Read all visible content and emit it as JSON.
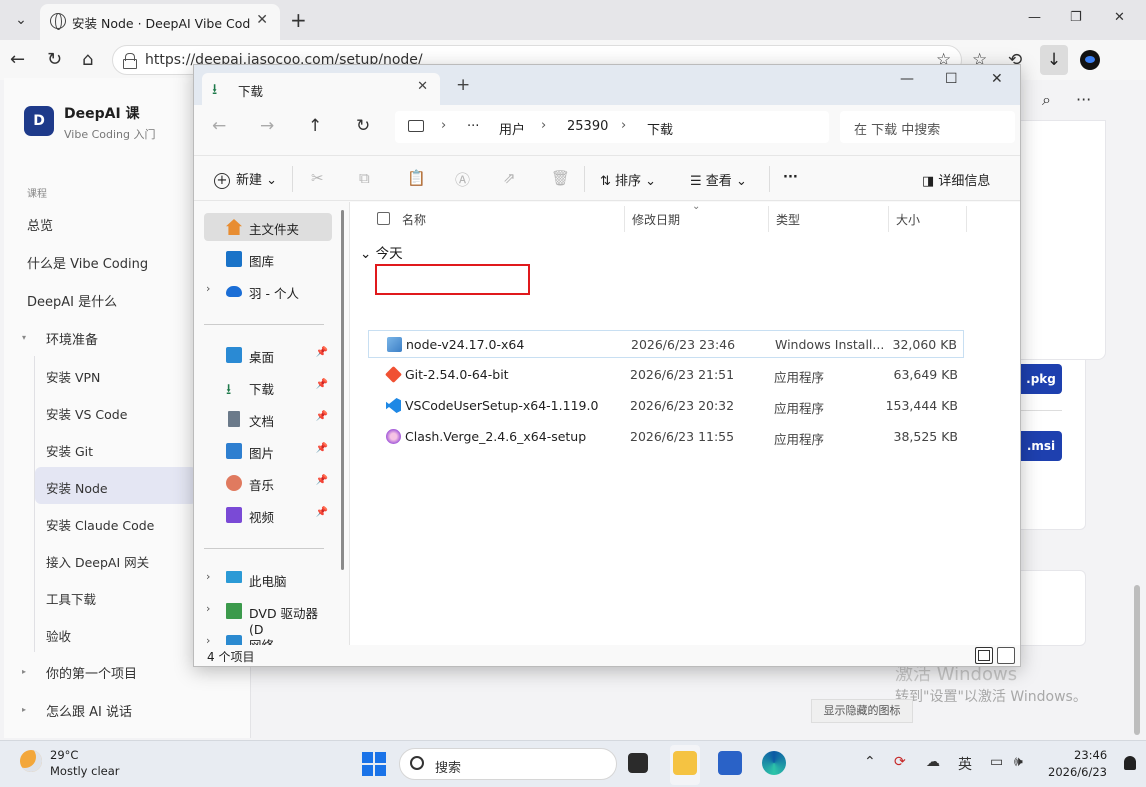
{
  "browser": {
    "tab_title": "安装 Node · DeepAI Vibe Coding 课",
    "url": "https://deepai.iasocoo.com/setup/node/"
  },
  "site": {
    "brand_initial": "D",
    "brand_title": "DeepAI 课",
    "brand_subtitle": "Vibe Coding 入门",
    "section_label": "课程",
    "nav": [
      {
        "label": "总览"
      },
      {
        "label": "什么是 Vibe Coding"
      },
      {
        "label": "DeepAI 是什么"
      },
      {
        "label": "环境准备"
      },
      {
        "label": "你的第一个项目"
      },
      {
        "label": "怎么跟 AI 说话"
      }
    ],
    "sub_nav": [
      {
        "label": "安装 VPN"
      },
      {
        "label": "安装 VS Code"
      },
      {
        "label": "安装 Git"
      },
      {
        "label": "安装 Node",
        "active": true
      },
      {
        "label": "安装 Claude Code"
      },
      {
        "label": "接入 DeepAI 网关"
      },
      {
        "label": "工具下载"
      },
      {
        "label": "验收"
      }
    ],
    "buttons": [
      ".pkg",
      ".msi"
    ]
  },
  "explorer": {
    "tab_title": "下载",
    "breadcrumb": [
      "···",
      "用户",
      "25390",
      "下载"
    ],
    "search_placeholder": "在 下载 中搜索",
    "commands": {
      "new": "新建",
      "sort": "排序",
      "view": "查看",
      "more": "···",
      "details": "详细信息"
    },
    "nav_pane": {
      "home": "主文件夹",
      "gallery": "图库",
      "onedrive": "羽 - 个人",
      "quick": [
        {
          "label": "桌面"
        },
        {
          "label": "下载"
        },
        {
          "label": "文档"
        },
        {
          "label": "图片"
        },
        {
          "label": "音乐"
        },
        {
          "label": "视频"
        }
      ],
      "this_pc": "此电脑",
      "dvd": "DVD 驱动器 (D",
      "network": "网络"
    },
    "columns": {
      "name": "名称",
      "modified": "修改日期",
      "type": "类型",
      "size": "大小"
    },
    "group": "今天",
    "files": [
      {
        "name": "node-v24.17.0-x64",
        "modified": "2026/6/23 23:46",
        "type": "Windows Install...",
        "size": "32,060 KB"
      },
      {
        "name": "Git-2.54.0-64-bit",
        "modified": "2026/6/23 21:51",
        "type": "应用程序",
        "size": "63,649 KB"
      },
      {
        "name": "VSCodeUserSetup-x64-1.119.0",
        "modified": "2026/6/23 20:32",
        "type": "应用程序",
        "size": "153,444 KB"
      },
      {
        "name": "Clash.Verge_2.4.6_x64-setup",
        "modified": "2026/6/23 11:55",
        "type": "应用程序",
        "size": "38,525 KB"
      }
    ],
    "status": "4 个项目"
  },
  "windows": {
    "activate_title": "激活 Windows",
    "activate_sub": "转到\"设置\"以激活 Windows。",
    "tooltip": "显示隐藏的图标"
  },
  "taskbar": {
    "temp": "29°C",
    "weather": "Mostly clear",
    "search": "搜索",
    "ime": "英",
    "time": "23:46",
    "date": "2026/6/23"
  }
}
